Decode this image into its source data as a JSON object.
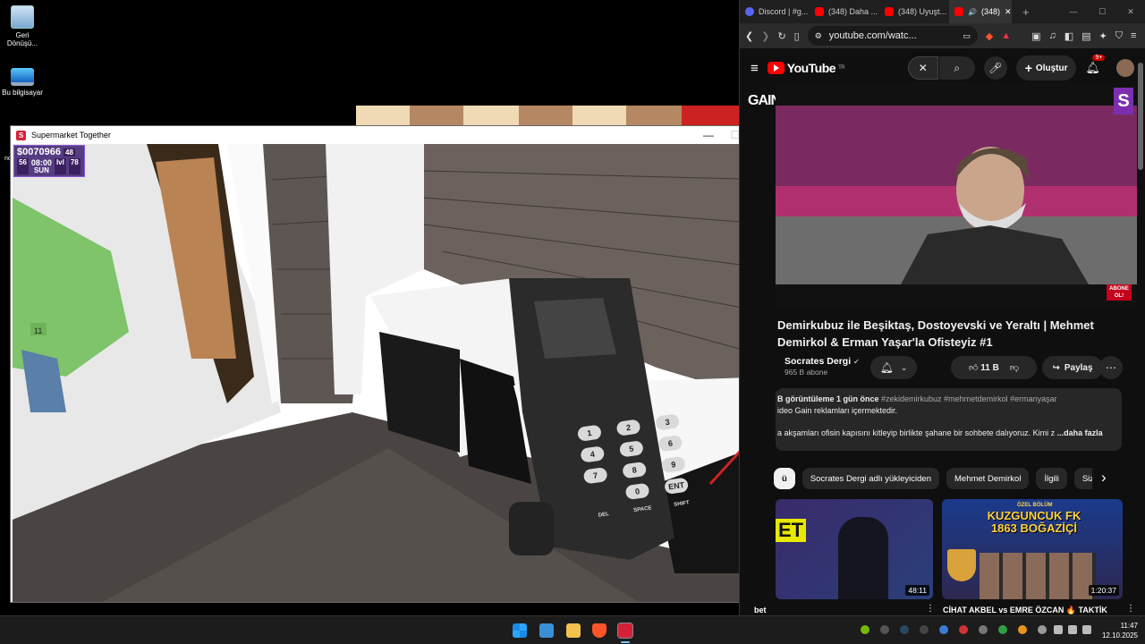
{
  "desktop": {
    "icons": [
      {
        "label": "Geri Dönüşü...",
        "icon": "recycle-bin-icon"
      },
      {
        "label": "Bu bilgisayar",
        "icon": "computer-icon"
      }
    ],
    "partial_label": "no"
  },
  "game_window": {
    "title": "Supermarket Together",
    "minimize": "—",
    "maximize": "☐",
    "close": "✕",
    "hud": {
      "money": "$0070966",
      "money_sub": "48",
      "left_num": "56",
      "time": "08:00",
      "day": "SUN",
      "right_num": "78",
      "right_label": "lvl"
    },
    "box_label": "11",
    "scanner_keys": [
      "1",
      "2",
      "3",
      "4",
      "5",
      "6",
      "7",
      "8",
      "9",
      "0",
      "ENT",
      "DEL",
      "SPACE",
      "SHIFT"
    ]
  },
  "browser": {
    "tabs": [
      {
        "label": "Discord | #g...",
        "color": "#5865f2"
      },
      {
        "label": "(348) Daha ...",
        "color": "#ff0000"
      },
      {
        "label": "(348) Uyuşt...",
        "color": "#ff0000"
      },
      {
        "label": "(348)",
        "color": "#ff0000"
      }
    ],
    "url": "youtube.com/watc...",
    "new_tab": "+",
    "min": "—",
    "max": "☐",
    "close": "✕"
  },
  "youtube": {
    "logo": "YouTube",
    "region": "TR",
    "create_label": "Oluştur",
    "notif_badge": "9+",
    "video": {
      "brand": "GAIN",
      "corner_badge": "S",
      "subscribe_sign": "ABONE OL!",
      "title": "Demirkubuz ile Beşiktaş, Dostoyevski ve Yeraltı | Mehmet Demirkol & Erman Yaşar'la Ofisteyiz #1",
      "channel": "Socrates Dergi",
      "subscribers": "965 B abone",
      "likes": "11 B",
      "share": "Paylaş",
      "more": "⋯",
      "desc_line1_views": "B görüntüleme  1 gün önce",
      "desc_line1_tags": "#zekidemirkubuz #mehmetdemirkol #ermanyaşar",
      "desc_line2": "ideo Gain reklamları içermektedir.",
      "desc_line3": "a akşamları ofisin kapısını kitleyip birlikte şahane bir sohbete dalıyoruz. Kimi z",
      "desc_more": "...daha fazla"
    },
    "chips": [
      "ü",
      "Socrates Dergi adlı yükleyiciden",
      "Mehmet Demirkol",
      "İlgili",
      "Size öze"
    ],
    "chip_next": "›",
    "recommendations": [
      {
        "badge_text": "ET",
        "duration": "48:11",
        "title": "bet",
        "overlay": ""
      },
      {
        "badge_text": "ÖZEL BÖLÜM",
        "duration": "1:20:37",
        "title": "CİHAT AKBEL vs EMRE ÖZCAN 🔥 TAKTİK",
        "overlay": "KUZGUNCUK FK 1863 BOĞAZİÇİ"
      }
    ]
  },
  "taskbar": {
    "time": "11:47",
    "date": "12.10.2025"
  }
}
